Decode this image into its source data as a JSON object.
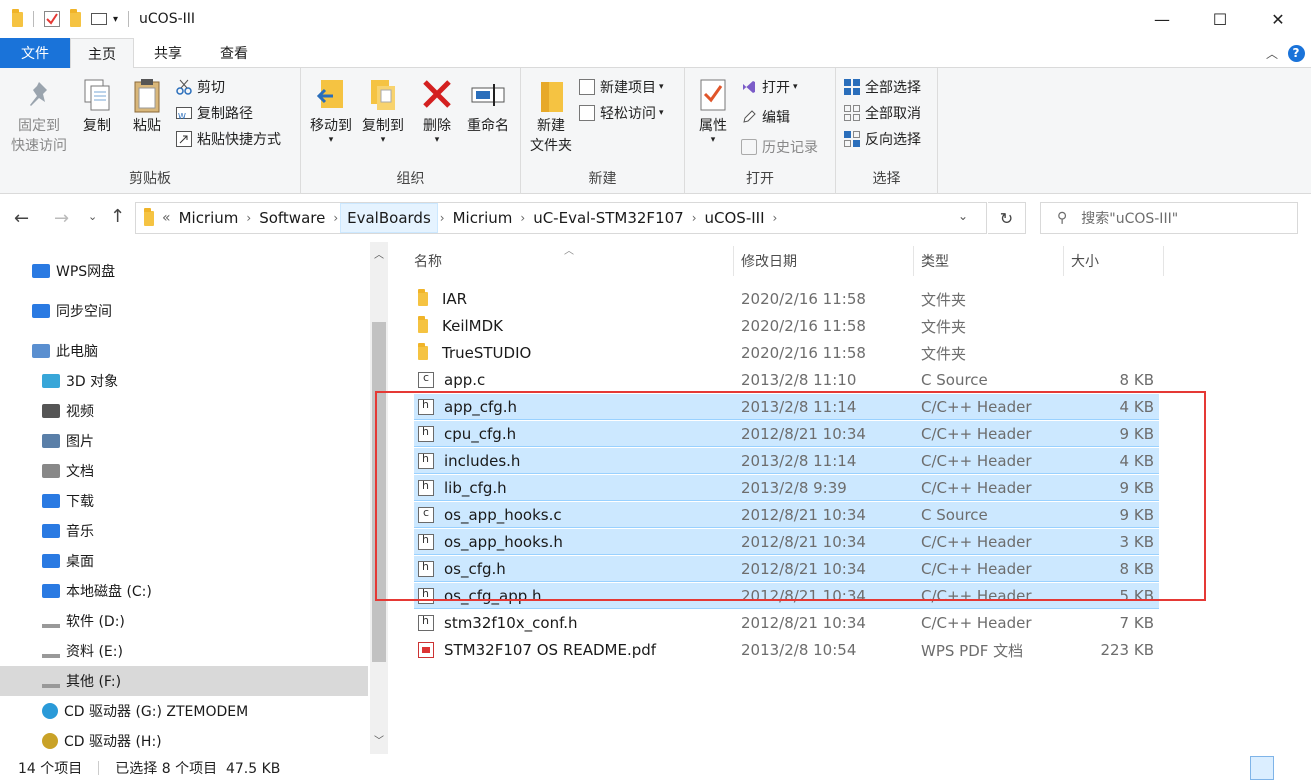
{
  "window": {
    "title": "uCOS-III",
    "minimize": "—",
    "maximize": "☐",
    "close": "✕"
  },
  "quick_access": {
    "customize": "▾"
  },
  "menu": {
    "tabs": [
      "文件",
      "主页",
      "共享",
      "查看"
    ],
    "active_tab": "主页",
    "file_tab_color": "#1a73d9",
    "help": "?"
  },
  "ribbon": {
    "clipboard": {
      "label": "剪贴板",
      "pin_label_1": "固定到",
      "pin_label_2": "快速访问",
      "copy_label": "复制",
      "paste_label": "粘贴",
      "cut_label": "剪切",
      "copy_path_label": "复制路径",
      "paste_shortcut_label": "粘贴快捷方式"
    },
    "organize": {
      "label": "组织",
      "move_to_label": "移动到",
      "copy_to_label": "复制到",
      "delete_label": "删除",
      "rename_label": "重命名"
    },
    "new": {
      "label": "新建",
      "new_folder_label_1": "新建",
      "new_folder_label_2": "文件夹",
      "new_item_label": "新建项目",
      "easy_access_label": "轻松访问"
    },
    "open": {
      "label": "打开",
      "properties_label": "属性",
      "open_label": "打开",
      "edit_label": "编辑",
      "history_label": "历史记录"
    },
    "select": {
      "label": "选择",
      "select_all_label": "全部选择",
      "select_none_label": "全部取消",
      "invert_label": "反向选择"
    }
  },
  "address": {
    "overflow": "«",
    "crumbs": [
      "Micrium",
      "Software",
      "EvalBoards",
      "Micrium",
      "uC-Eval-STM32F107",
      "uCOS-III"
    ],
    "search_placeholder": "搜索\"uCOS-III\""
  },
  "nav": {
    "items": [
      {
        "label": "WPS网盘",
        "icon": "cloud-icon"
      },
      {
        "label": "同步空间",
        "icon": "sync-icon"
      },
      {
        "label": "此电脑",
        "icon": "computer-icon"
      },
      {
        "label": "3D 对象",
        "icon": "cube-icon"
      },
      {
        "label": "视频",
        "icon": "video-icon"
      },
      {
        "label": "图片",
        "icon": "picture-icon"
      },
      {
        "label": "文档",
        "icon": "document-icon"
      },
      {
        "label": "下载",
        "icon": "download-icon"
      },
      {
        "label": "音乐",
        "icon": "music-icon"
      },
      {
        "label": "桌面",
        "icon": "desktop-icon"
      },
      {
        "label": "本地磁盘 (C:)",
        "icon": "windows-drive-icon"
      },
      {
        "label": "软件 (D:)",
        "icon": "drive-icon"
      },
      {
        "label": "资料 (E:)",
        "icon": "drive-icon"
      },
      {
        "label": "其他 (F:)",
        "icon": "drive-icon"
      },
      {
        "label": "CD 驱动器 (G:) ZTEMODEM",
        "icon": "cd-drive-icon"
      },
      {
        "label": "CD 驱动器 (H:)",
        "icon": "cd-icon"
      }
    ],
    "selected_index": 13
  },
  "columns": {
    "name": "名称",
    "date": "修改日期",
    "type": "类型",
    "size": "大小"
  },
  "files": [
    {
      "name": "IAR",
      "date": "2020/2/16 11:58",
      "type": "文件夹",
      "size": "",
      "kind": "folder",
      "selected": false
    },
    {
      "name": "KeilMDK",
      "date": "2020/2/16 11:58",
      "type": "文件夹",
      "size": "",
      "kind": "folder",
      "selected": false
    },
    {
      "name": "TrueSTUDIO",
      "date": "2020/2/16 11:58",
      "type": "文件夹",
      "size": "",
      "kind": "folder",
      "selected": false
    },
    {
      "name": "app.c",
      "date": "2013/2/8 11:10",
      "type": "C Source",
      "size": "8 KB",
      "kind": "c",
      "selected": false
    },
    {
      "name": "app_cfg.h",
      "date": "2013/2/8 11:14",
      "type": "C/C++ Header",
      "size": "4 KB",
      "kind": "h",
      "selected": true
    },
    {
      "name": "cpu_cfg.h",
      "date": "2012/8/21 10:34",
      "type": "C/C++ Header",
      "size": "9 KB",
      "kind": "h",
      "selected": true
    },
    {
      "name": "includes.h",
      "date": "2013/2/8 11:14",
      "type": "C/C++ Header",
      "size": "4 KB",
      "kind": "h",
      "selected": true
    },
    {
      "name": "lib_cfg.h",
      "date": "2013/2/8 9:39",
      "type": "C/C++ Header",
      "size": "9 KB",
      "kind": "h",
      "selected": true
    },
    {
      "name": "os_app_hooks.c",
      "date": "2012/8/21 10:34",
      "type": "C Source",
      "size": "9 KB",
      "kind": "c",
      "selected": true
    },
    {
      "name": "os_app_hooks.h",
      "date": "2012/8/21 10:34",
      "type": "C/C++ Header",
      "size": "3 KB",
      "kind": "h",
      "selected": true
    },
    {
      "name": "os_cfg.h",
      "date": "2012/8/21 10:34",
      "type": "C/C++ Header",
      "size": "8 KB",
      "kind": "h",
      "selected": true
    },
    {
      "name": "os_cfg_app.h",
      "date": "2012/8/21 10:34",
      "type": "C/C++ Header",
      "size": "5 KB",
      "kind": "h",
      "selected": true
    },
    {
      "name": "stm32f10x_conf.h",
      "date": "2012/8/21 10:34",
      "type": "C/C++ Header",
      "size": "7 KB",
      "kind": "h",
      "selected": false
    },
    {
      "name": "STM32F107 OS README.pdf",
      "date": "2013/2/8 10:54",
      "type": "WPS PDF 文档",
      "size": "223 KB",
      "kind": "pdf",
      "selected": false
    }
  ],
  "status": {
    "item_count": "14 个项目",
    "selection": "已选择 8 个项目  47.5 KB"
  },
  "colors": {
    "selection_bg": "#cce8ff",
    "annotation_red": "#e53935",
    "accent_blue": "#1a73d9"
  }
}
